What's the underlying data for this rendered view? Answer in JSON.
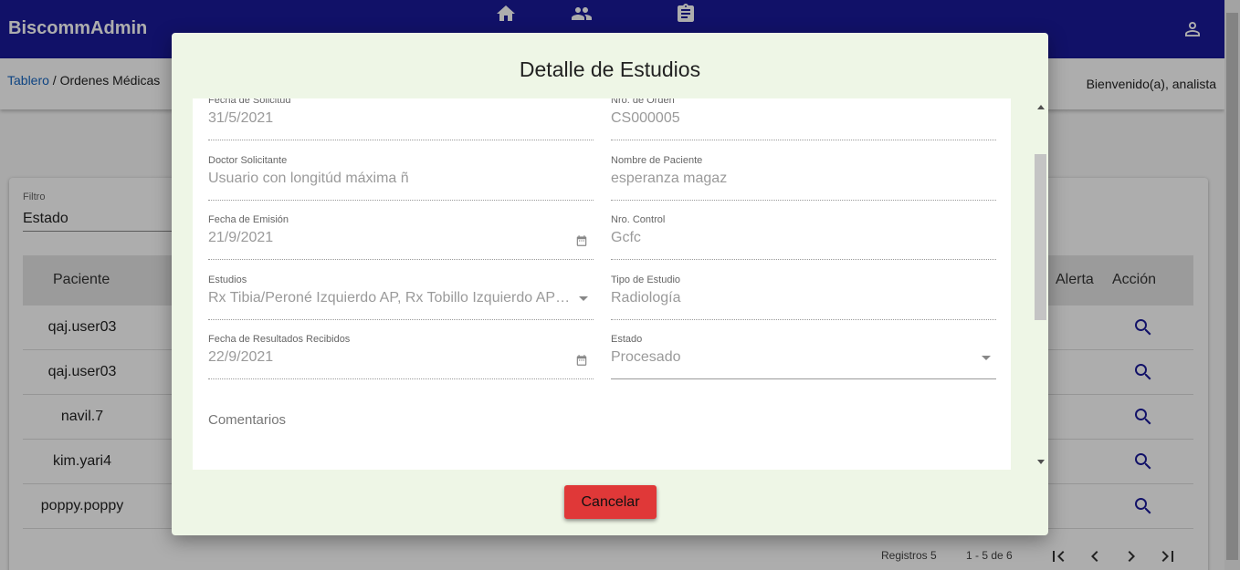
{
  "app": {
    "brand": "BiscommAdmin",
    "nav_icons": [
      "home-icon",
      "group-icon",
      "assignment-icon"
    ],
    "account_icon": "account-icon"
  },
  "subbar": {
    "breadcrumb_link": "Tablero",
    "breadcrumb_sep": " / ",
    "breadcrumb_current": "Ordenes Médicas",
    "welcome": "Bienvenido(a), analista"
  },
  "filter": {
    "label": "Filtro",
    "value": "Estado"
  },
  "table": {
    "headers": {
      "patient": "Paciente",
      "alert": "Alerta",
      "action": "Acción"
    },
    "rows": [
      {
        "patient": "qaj.user03"
      },
      {
        "patient": "qaj.user03"
      },
      {
        "patient": "navil.7"
      },
      {
        "patient": "kim.yari4"
      },
      {
        "patient": "poppy.poppy"
      }
    ]
  },
  "pagination": {
    "records": "Registros 5",
    "range": "1 - 5 de 6"
  },
  "dialog": {
    "title": "Detalle de Estudios",
    "fields": {
      "request_date": {
        "label": "Fecha de Solicitud",
        "value": "31/5/2021"
      },
      "order_no": {
        "label": "Nro. de Orden",
        "value": "CS000005"
      },
      "doctor": {
        "label": "Doctor Solicitante",
        "value": "Usuario con longitúd máxima ñ"
      },
      "patient_name": {
        "label": "Nombre de Paciente",
        "value": "esperanza magaz"
      },
      "issue_date": {
        "label": "Fecha de Emisión",
        "value": "21/9/2021"
      },
      "control_no": {
        "label": "Nro. Control",
        "value": "Gcfc"
      },
      "studies": {
        "label": "Estudios",
        "value": "Rx Tibia/Peroné Izquierdo AP, Rx Tobillo Izquierdo AP/L..."
      },
      "study_type": {
        "label": "Tipo de Estudio",
        "value": "Radiología"
      },
      "results_date": {
        "label": "Fecha de Resultados Recibidos",
        "value": "22/9/2021"
      },
      "status": {
        "label": "Estado",
        "value": "Procesado"
      }
    },
    "comments_placeholder": "Comentarios",
    "cancel_label": "Cancelar"
  },
  "colors": {
    "topbar": "#1a1a9a",
    "dialog_bg": "#eef6e6",
    "cancel_button": "#e03838",
    "link": "#1565c0"
  }
}
